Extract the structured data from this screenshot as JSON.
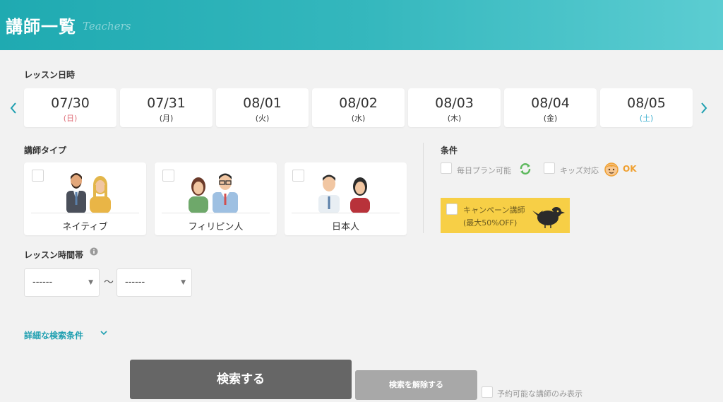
{
  "header": {
    "title": "講師一覧",
    "subtitle": "Teachers"
  },
  "lesson_date": {
    "label": "レッスン日時",
    "dates": [
      {
        "date": "07/30",
        "weekday": "(日)",
        "kind": "sun"
      },
      {
        "date": "07/31",
        "weekday": "(月)",
        "kind": "normal"
      },
      {
        "date": "08/01",
        "weekday": "(火)",
        "kind": "normal"
      },
      {
        "date": "08/02",
        "weekday": "(水)",
        "kind": "normal"
      },
      {
        "date": "08/03",
        "weekday": "(木)",
        "kind": "normal"
      },
      {
        "date": "08/04",
        "weekday": "(金)",
        "kind": "normal"
      },
      {
        "date": "08/05",
        "weekday": "(土)",
        "kind": "sat"
      }
    ],
    "prev_icon": "chevron-left-icon",
    "next_icon": "chevron-right-icon"
  },
  "teacher_type": {
    "label": "講師タイプ",
    "options": [
      {
        "label": "ネイティブ",
        "checked": false
      },
      {
        "label": "フィリピン人",
        "checked": false
      },
      {
        "label": "日本人",
        "checked": false
      }
    ]
  },
  "conditions": {
    "label": "条件",
    "daily_plan": "毎日プラン可能",
    "kids": "キッズ対応",
    "kids_ok": "OK",
    "campaign_line1": "キャンペーン講師",
    "campaign_line2": "(最大50%OFF)"
  },
  "time_range": {
    "label": "レッスン時間帯",
    "from": "------",
    "to": "------",
    "separator": "〜"
  },
  "advanced_search": "詳細な検索条件",
  "actions": {
    "search": "検索する",
    "clear": "検索を解除する",
    "available_only": "予約可能な講師のみ表示"
  },
  "colors": {
    "header_start": "#1faab1",
    "header_end": "#5ccdd2",
    "accent": "#1e9fb0",
    "campaign_bg": "#f7cf46",
    "search_button": "#666666",
    "clear_button": "#a8a8a8",
    "ok_orange": "#f0a030",
    "refresh_green": "#5cb85c"
  }
}
